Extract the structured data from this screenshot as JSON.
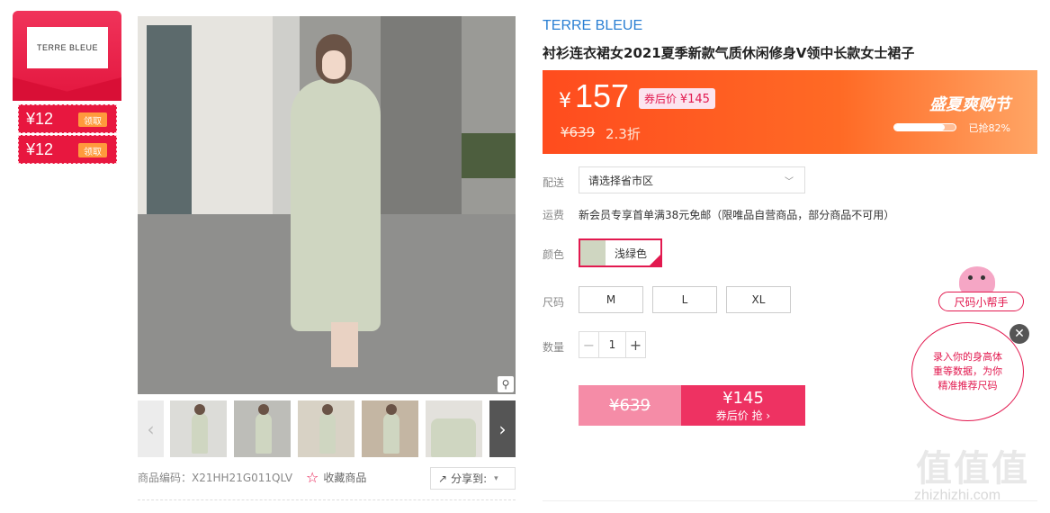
{
  "brand": {
    "logo_text": "TERRE BLEUE",
    "name": "TERRE BLEUE"
  },
  "coupons": [
    {
      "amount": "¥12",
      "claim_label": "领取"
    },
    {
      "amount": "¥12",
      "claim_label": "领取"
    }
  ],
  "product": {
    "title": "衬衫连衣裙女2021夏季新款气质休闲修身V领中长款女士裙子",
    "sku_label": "商品编码：",
    "sku": "X21HH21G011QLV",
    "favorite_label": "收藏商品",
    "share_label": "分享到:"
  },
  "price_banner": {
    "currency": "¥",
    "price": "157",
    "after_coupon_label": "券后价",
    "after_coupon_price": "¥145",
    "original_price": "¥639",
    "discount": "2.3折",
    "festival": "盛夏爽购节",
    "grabbed_text": "已抢82%",
    "grabbed_percent": 82
  },
  "delivery": {
    "label": "配送",
    "select_value": "请选择省市区"
  },
  "shipping": {
    "label": "运费",
    "text": "新会员专享首单满38元免邮（限唯品自营商品，部分商品不可用）"
  },
  "color": {
    "label": "颜色",
    "option": "浅绿色"
  },
  "size": {
    "label": "尺码",
    "options": [
      "M",
      "L",
      "XL"
    ]
  },
  "quantity": {
    "label": "数量",
    "value": "1",
    "minus": "−",
    "plus": "+"
  },
  "buy_button": {
    "original_price": "¥639",
    "price": "¥145",
    "action": "券后价 抢 ›"
  },
  "size_helper": {
    "label": "尺码小帮手",
    "bubble_text": "录入你的身高体重等数据，为你精准推荐尺码",
    "close": "✕"
  },
  "gallery": {
    "prev": "‹",
    "next": "›",
    "zoom": "⚲"
  },
  "watermark": {
    "logo": "值值值",
    "url": "zhizhizhi.com"
  }
}
